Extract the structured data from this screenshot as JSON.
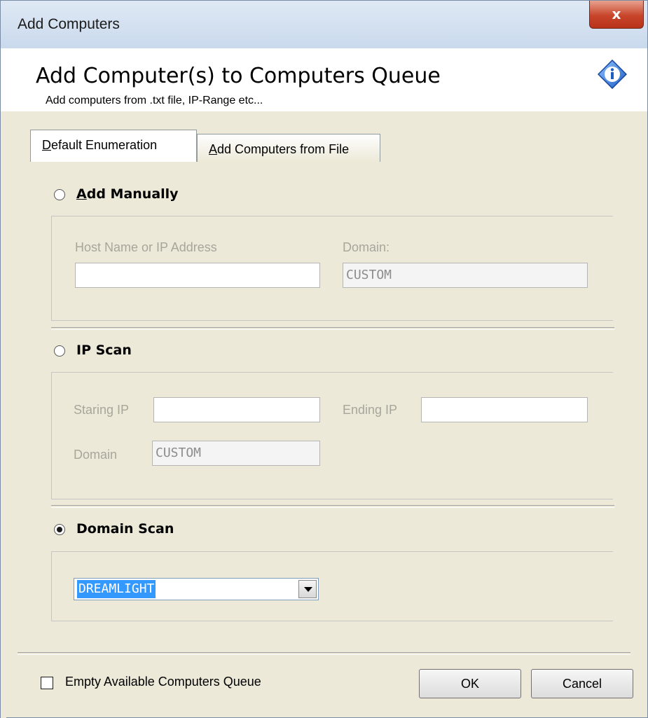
{
  "window": {
    "title": "Add Computers",
    "close_label": "x"
  },
  "header": {
    "title": "Add Computer(s) to Computers Queue",
    "subtitle": "Add computers from .txt file, IP-Range etc...",
    "icon": "info-icon"
  },
  "tabs": [
    {
      "label": "Default Enumeration",
      "accel": "D",
      "rest": "efault Enumeration",
      "active": true
    },
    {
      "label": "Add Computers from File",
      "accel": "A",
      "rest": "dd Computers from File",
      "active": false
    }
  ],
  "manual": {
    "radio_accel": "A",
    "radio_rest": "dd Manually",
    "selected": false,
    "host_label": "Host Name or IP Address",
    "host_value": "",
    "domain_label": "Domain:",
    "domain_value": "CUSTOM"
  },
  "ipscan": {
    "radio_label": "IP Scan",
    "selected": false,
    "start_label": "Staring IP",
    "start_value": "",
    "end_label": "Ending IP",
    "end_value": "",
    "domain_label": "Domain",
    "domain_value": "CUSTOM"
  },
  "domainscan": {
    "radio_label": "Domain Scan",
    "selected": true,
    "domain_value": "DREAMLIGHT"
  },
  "footer": {
    "checkbox_label": "Empty Available Computers Queue",
    "checkbox_checked": false,
    "ok_label": "OK",
    "cancel_label": "Cancel"
  }
}
